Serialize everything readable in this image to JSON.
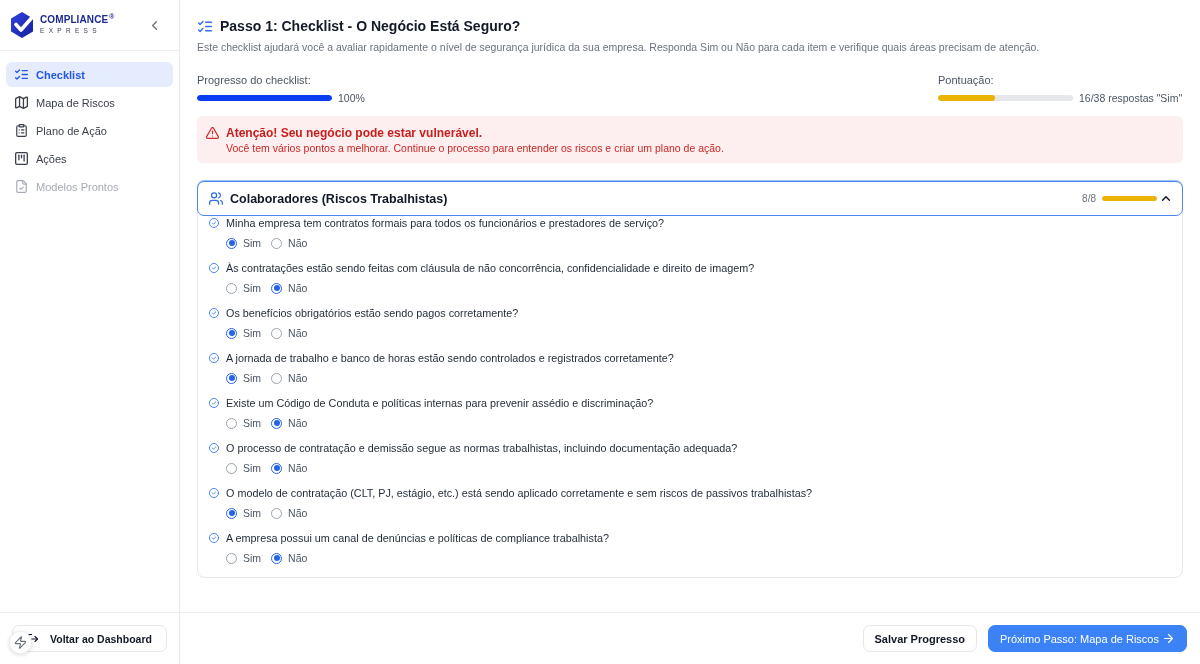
{
  "sidebar": {
    "logo": {
      "name": "COMPLIANCE",
      "mark": "®",
      "tagline": "EXPRESS"
    },
    "items": [
      {
        "label": "Checklist",
        "selected": true,
        "disabled": false
      },
      {
        "label": "Mapa de Riscos",
        "selected": false,
        "disabled": false
      },
      {
        "label": "Plano de Ação",
        "selected": false,
        "disabled": false
      },
      {
        "label": "Ações",
        "selected": false,
        "disabled": false
      },
      {
        "label": "Modelos Prontos",
        "selected": false,
        "disabled": true
      }
    ],
    "back_button": "Voltar ao Dashboard"
  },
  "header": {
    "title": "Passo 1: Checklist - O Negócio Está Seguro?",
    "description": "Este checklist ajudará você a avaliar rapidamente o nível de segurança jurídica da sua empresa. Responda Sim ou Não para cada item e verifique quais áreas precisam de atenção."
  },
  "progress": {
    "label": "Progresso do checklist:",
    "level": 1,
    "reading": "100%"
  },
  "score": {
    "label": "Pontuação:",
    "level": 0.42,
    "reading": "16/38 respostas \"Sim\""
  },
  "alert": {
    "title": "Atenção! Seu negócio pode estar vulnerável.",
    "message": "Você tem vários pontos a melhorar. Continue o processo para entender os riscos e criar um plano de ação."
  },
  "section": {
    "title": "Colaboradores (Riscos Trabalhistas)",
    "count": "8/8",
    "level": 1,
    "expanded": true,
    "questions": [
      {
        "text": "Minha empresa tem contratos formais para todos os funcionários e prestadores de serviço?",
        "answered": true,
        "options": [
          {
            "label": "Sim",
            "selected": true
          },
          {
            "label": "Não",
            "selected": false
          }
        ]
      },
      {
        "text": "Às contratações estão sendo feitas com cláusula de não concorrência, confidencialidade e direito de imagem?",
        "answered": true,
        "options": [
          {
            "label": "Sim",
            "selected": false
          },
          {
            "label": "Não",
            "selected": true
          }
        ]
      },
      {
        "text": "Os benefícios obrigatórios estão sendo pagos corretamente?",
        "answered": true,
        "options": [
          {
            "label": "Sim",
            "selected": true
          },
          {
            "label": "Não",
            "selected": false
          }
        ]
      },
      {
        "text": "A jornada de trabalho e banco de horas estão sendo controlados e registrados corretamente?",
        "answered": true,
        "options": [
          {
            "label": "Sim",
            "selected": true
          },
          {
            "label": "Não",
            "selected": false
          }
        ]
      },
      {
        "text": "Existe um Código de Conduta e políticas internas para prevenir assédio e discriminação?",
        "answered": true,
        "options": [
          {
            "label": "Sim",
            "selected": false
          },
          {
            "label": "Não",
            "selected": true
          }
        ]
      },
      {
        "text": "O processo de contratação e demissão segue as normas trabalhistas, incluindo documentação adequada?",
        "answered": true,
        "options": [
          {
            "label": "Sim",
            "selected": false
          },
          {
            "label": "Não",
            "selected": true
          }
        ]
      },
      {
        "text": "O modelo de contratação (CLT, PJ, estágio, etc.) está sendo aplicado corretamente e sem riscos de passivos trabalhistas?",
        "answered": true,
        "options": [
          {
            "label": "Sim",
            "selected": true
          },
          {
            "label": "Não",
            "selected": false
          }
        ]
      },
      {
        "text": "A empresa possui um canal de denúncias e políticas de compliance trabalhista?",
        "answered": true,
        "options": [
          {
            "label": "Sim",
            "selected": false
          },
          {
            "label": "Não",
            "selected": true
          }
        ]
      }
    ]
  },
  "footer": {
    "buttons": [
      {
        "label": "Salvar Progresso",
        "kind": "secondary"
      },
      {
        "label": "Próximo Passo: Mapa de Riscos",
        "kind": "primary"
      }
    ]
  }
}
